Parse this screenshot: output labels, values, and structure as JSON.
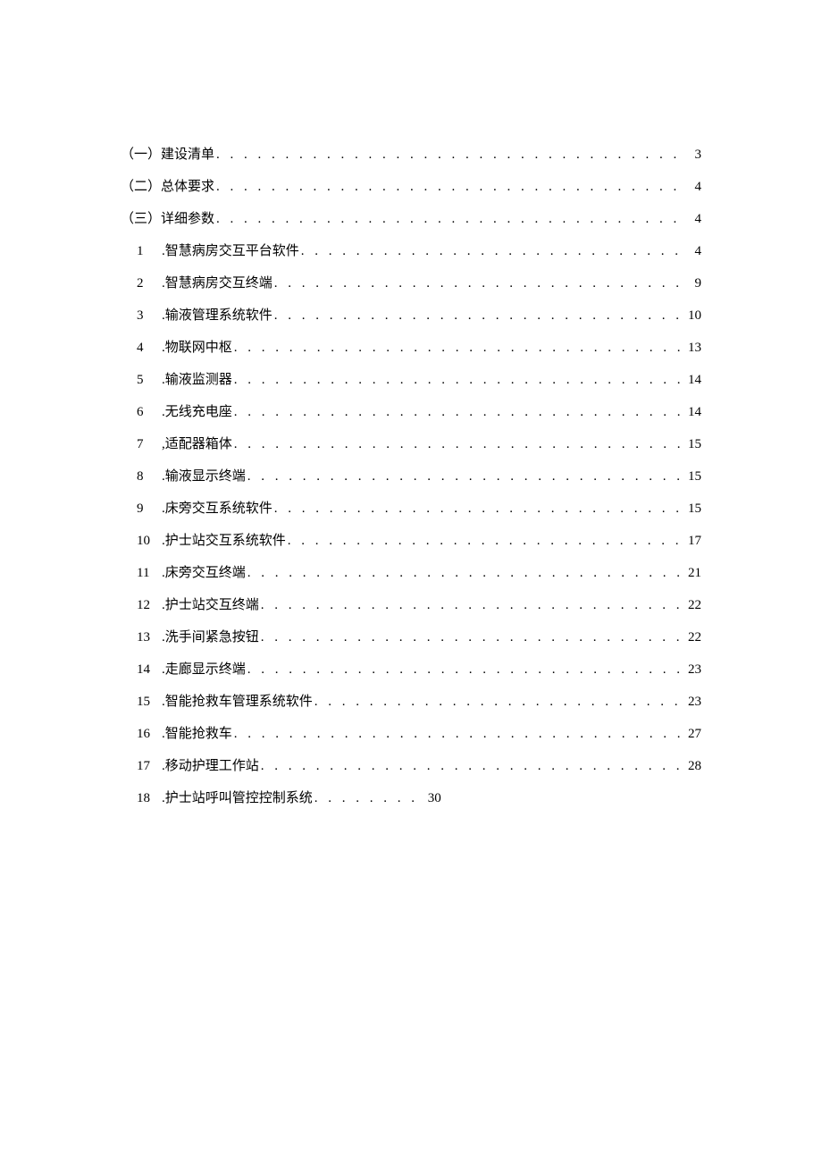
{
  "toc": [
    {
      "level": 1,
      "num": "",
      "title": "（一）建设清单",
      "page": "3"
    },
    {
      "level": 1,
      "num": "",
      "title": "（二）总体要求",
      "page": "4"
    },
    {
      "level": 1,
      "num": "",
      "title": "（三）详细参数",
      "page": "4"
    },
    {
      "level": 2,
      "num": "1",
      "title": ".智慧病房交互平台软件",
      "page": "4"
    },
    {
      "level": 2,
      "num": "2",
      "title": ".智慧病房交互终端",
      "page": "9"
    },
    {
      "level": 2,
      "num": "3",
      "title": ".输液管理系统软件",
      "page": "10"
    },
    {
      "level": 2,
      "num": "4",
      "title": ".物联网中枢",
      "page": "13"
    },
    {
      "level": 2,
      "num": "5",
      "title": ".输液监测器",
      "page": "14"
    },
    {
      "level": 2,
      "num": "6",
      "title": ".无线充电座",
      "page": "14"
    },
    {
      "level": 2,
      "num": "7",
      "title": ",适配器箱体",
      "page": "15"
    },
    {
      "level": 2,
      "num": "8",
      "title": ".输液显示终端",
      "page": "15"
    },
    {
      "level": 2,
      "num": "9",
      "title": ".床旁交互系统软件",
      "page": "15"
    },
    {
      "level": 2,
      "num": "10",
      "title": ".护士站交互系统软件",
      "page": "17"
    },
    {
      "level": 2,
      "num": "11",
      "title": ".床旁交互终端",
      "page": "21"
    },
    {
      "level": 2,
      "num": "12",
      "title": ".护士站交互终端",
      "page": "22"
    },
    {
      "level": 2,
      "num": "13",
      "title": ".洗手间紧急按钮",
      "page": "22"
    },
    {
      "level": 2,
      "num": "14",
      "title": ".走廊显示终端",
      "page": "23"
    },
    {
      "level": 2,
      "num": "15",
      "title": ".智能抢救车管理系统软件",
      "page": "23"
    },
    {
      "level": 2,
      "num": "16",
      "title": ".智能抢救车",
      "page": "27"
    },
    {
      "level": 2,
      "num": "17",
      "title": ".移动护理工作站",
      "page": "28"
    },
    {
      "level": 2,
      "num": "18",
      "title": ".护士站呼叫管控控制系统",
      "page": "30"
    }
  ],
  "dot_fill": ". . . . . . . . . . . . . . . . . . . . . . . . . . . . . . . . . . . . . . . . . . . . . . . . . . . . . . . . . . . . . . . . . . . . . . . . . . . . . . . ."
}
